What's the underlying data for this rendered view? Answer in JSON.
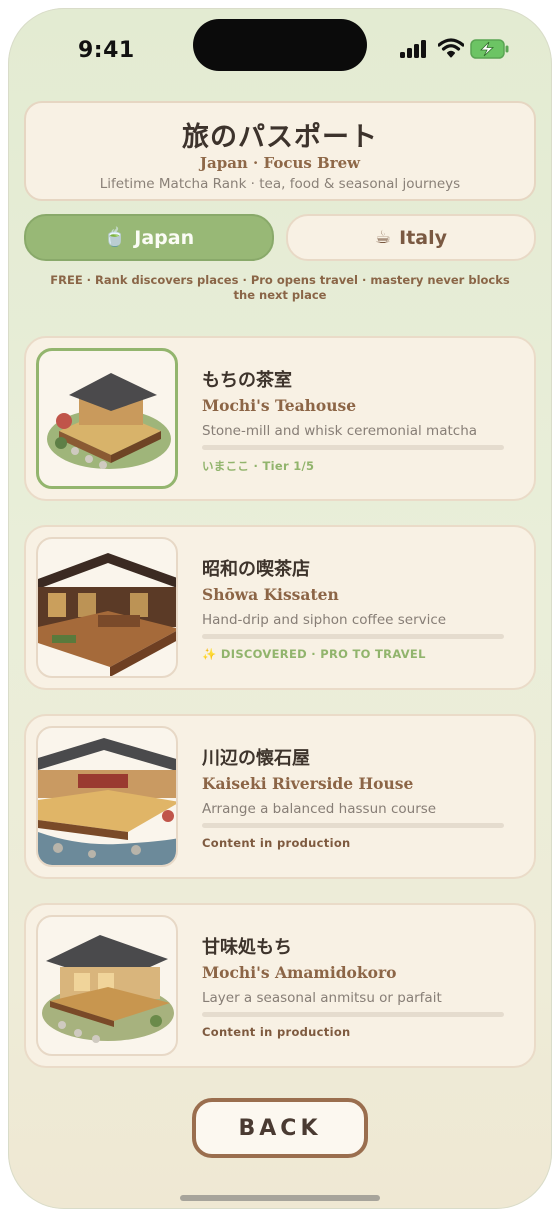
{
  "status_bar": {
    "time": "9:41"
  },
  "header": {
    "title": "旅のパスポート",
    "subtitle": "Japan · Focus Brew",
    "description": "Lifetime Matcha Rank · tea, food & seasonal journeys"
  },
  "tabs": [
    {
      "icon": "🍵",
      "icon_name": "matcha-bowl-icon",
      "label": "Japan",
      "selected": true
    },
    {
      "icon": "☕",
      "icon_name": "coffee-cup-icon",
      "label": "Italy",
      "selected": false
    }
  ],
  "notice": "FREE · Rank discovers places · Pro opens travel · mastery never blocks the next place",
  "places": [
    {
      "name_jp": "もちの茶室",
      "name_en": "Mochi's Teahouse",
      "description": "Stone-mill and whisk ceremonial matcha",
      "status": "いまここ · Tier 1/5",
      "status_kind": "current",
      "progress": 0
    },
    {
      "name_jp": "昭和の喫茶店",
      "name_en": "Shōwa Kissaten",
      "description": "Hand-drip and siphon coffee service",
      "status": "✨ DISCOVERED · PRO TO TRAVEL",
      "status_kind": "discovered",
      "progress": 0
    },
    {
      "name_jp": "川辺の懐石屋",
      "name_en": "Kaiseki Riverside House",
      "description": "Arrange a balanced hassun course",
      "status": "Content in production",
      "status_kind": "production",
      "progress": 0
    },
    {
      "name_jp": "甘味処もち",
      "name_en": "Mochi's Amamidokoro",
      "description": "Layer a seasonal anmitsu or parfait",
      "status": "Content in production",
      "status_kind": "production",
      "progress": 0
    }
  ],
  "back_button": "BACK",
  "colors": {
    "accent_green": "#98b876",
    "brown": "#8c6546",
    "card_bg": "#f8f1e4"
  }
}
